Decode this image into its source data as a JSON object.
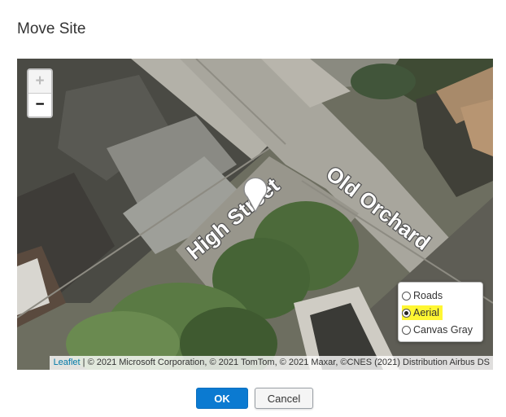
{
  "dialog": {
    "title": "Move Site"
  },
  "map": {
    "zoom_in_label": "+",
    "zoom_out_label": "−",
    "street_labels": [
      "High Street",
      "Old Orchard"
    ],
    "layers": {
      "options": [
        "Roads",
        "Aerial",
        "Canvas Gray"
      ],
      "selected": "Aerial"
    },
    "attribution": {
      "link_text": "Leaflet",
      "text": " | © 2021 Microsoft Corporation, © 2021 TomTom, © 2021 Maxar, ©CNES (2021) Distribution Airbus DS"
    }
  },
  "buttons": {
    "ok_label": "OK",
    "cancel_label": "Cancel"
  },
  "colors": {
    "primary_button": "#0b7ad1",
    "selected_layer_highlight": "#fff633",
    "attribution_link": "#0078a8"
  },
  "icons": {
    "marker": "map-pin-icon"
  }
}
